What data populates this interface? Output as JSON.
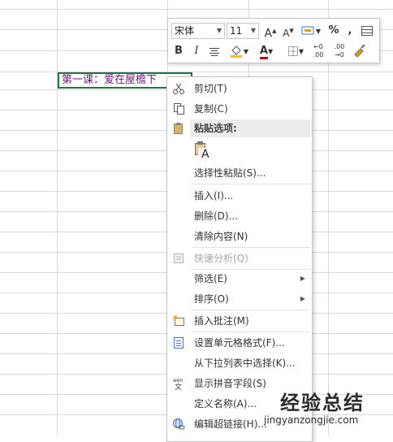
{
  "cell": {
    "text": "第一课：爱在屋檐下"
  },
  "toolbar": {
    "font_name": "宋体",
    "font_size": "11",
    "grow_font": "A",
    "shrink_font": "A",
    "percent": "%",
    "comma": ",",
    "bold": "B",
    "italic": "I",
    "font_color_letter": "A",
    "inc_decimal": ".00",
    "dec_decimal": ".00",
    "accent_red": "#c00000"
  },
  "menu": {
    "cut": "剪切(T)",
    "copy": "复制(C)",
    "paste_options": "粘贴选项:",
    "paste_glyph": "A",
    "paste_special": "选择性粘贴(S)...",
    "insert": "插入(I)...",
    "delete": "删除(D)...",
    "clear": "清除内容(N)",
    "quick_analysis": "快速分析(Q)",
    "filter": "筛选(E)",
    "sort": "排序(O)",
    "insert_comment": "插入批注(M)",
    "format_cells": "设置单元格格式(F)...",
    "pick_list": "从下拉列表中选择(K)...",
    "phonetic": "显示拼音字段(S)",
    "define_name": "定义名称(A)...",
    "hyperlink": "编辑超链接(H)..."
  },
  "watermark": {
    "title": "经验总结",
    "url": "jingyanzongjie.com"
  }
}
